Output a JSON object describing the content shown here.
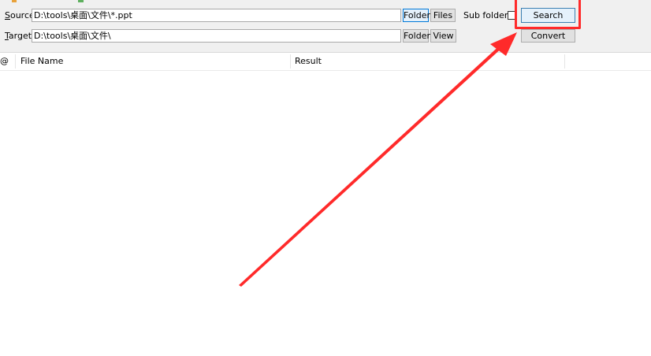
{
  "source": {
    "label_accel": "S",
    "label_rest": "ource",
    "value": "D:\\tools\\桌面\\文件\\*.ppt",
    "folder_button": "Folder",
    "files_button": "Files",
    "subfolders_label": "Sub folders",
    "subfolders_checked": false,
    "search_button": "Search"
  },
  "target": {
    "label_accel": "T",
    "label_rest": "arget",
    "value": "D:\\tools\\桌面\\文件\\",
    "folder_button": "Folder",
    "view_button": "View",
    "convert_button": "Convert"
  },
  "table": {
    "columns": [
      "@",
      "File Name",
      "Result"
    ],
    "rows": []
  },
  "annotation": {
    "highlight_color": "#ff2a2a",
    "target_element": "search-button"
  }
}
